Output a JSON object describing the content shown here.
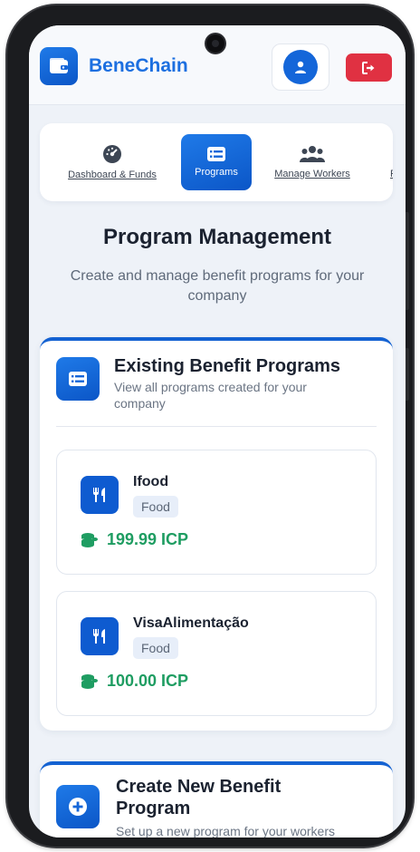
{
  "app": {
    "name": "BeneChain"
  },
  "header": {
    "logo_icon": "wallet-icon",
    "profile_icon": "user-icon",
    "logout_icon": "sign-out-icon"
  },
  "nav": {
    "tabs": [
      {
        "label": "Dashboard & Funds",
        "icon": "gauge-icon",
        "active": false
      },
      {
        "label": "Programs",
        "icon": "list-card-icon",
        "active": true
      },
      {
        "label": "Manage Workers",
        "icon": "users-icon",
        "active": false
      },
      {
        "label": "R",
        "icon": "",
        "active": false
      }
    ]
  },
  "page": {
    "title": "Program Management",
    "subtitle": "Create and manage benefit programs for your company"
  },
  "existing_programs": {
    "title": "Existing Benefit Programs",
    "description": "View all programs created for your company",
    "icon": "list-card-icon",
    "programs": [
      {
        "name": "Ifood",
        "category": "Food",
        "amount": "199.99 ICP",
        "icon": "utensils-icon",
        "amount_icon": "coins-icon"
      },
      {
        "name": "VisaAlimentação",
        "category": "Food",
        "amount": "100.00 ICP",
        "icon": "utensils-icon",
        "amount_icon": "coins-icon"
      }
    ]
  },
  "create_program": {
    "title": "Create New Benefit Program",
    "description": "Set up a new program for your workers",
    "icon": "plus-circle-icon"
  },
  "colors": {
    "primary": "#1466d9",
    "danger": "#e03142",
    "success": "#1f9d62",
    "background": "#eef2f8"
  }
}
